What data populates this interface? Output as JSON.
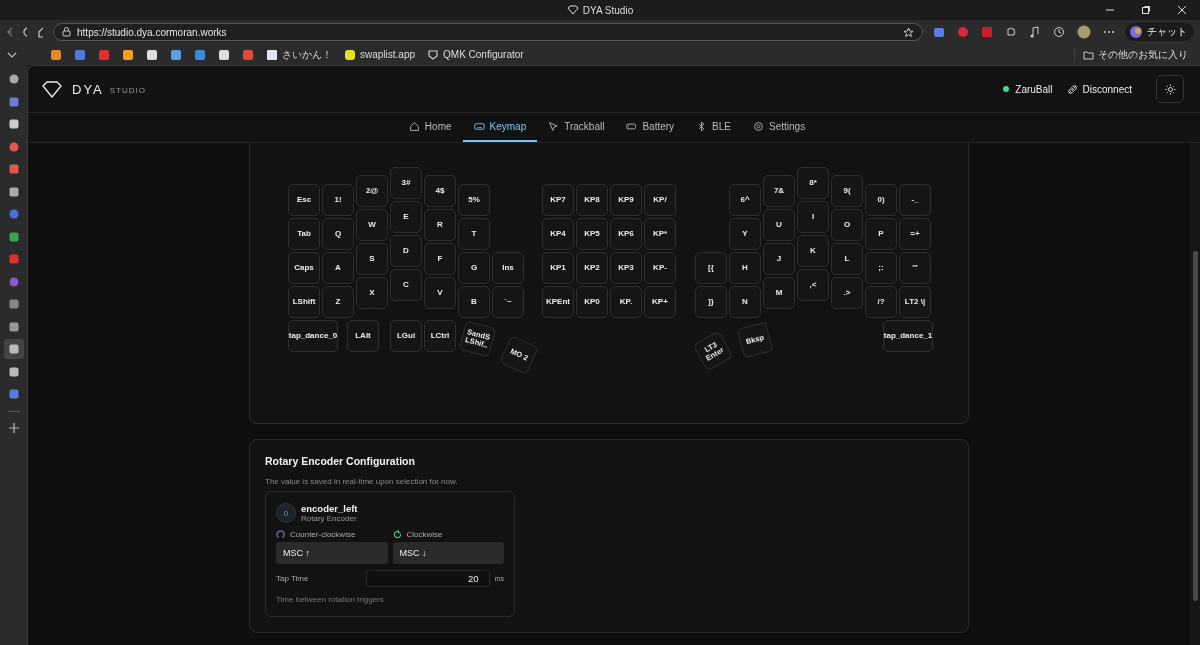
{
  "browser": {
    "title": "DYA Studio",
    "url": "https://studio.dya.cormoran.works",
    "chat_button": "チャット",
    "bookmarks": [
      {
        "label": "さいかん！"
      },
      {
        "label": "swaplist.app"
      },
      {
        "label": "QMK Configurator"
      }
    ],
    "other_bookmarks": "その他のお気に入り"
  },
  "app": {
    "brand": "DYA",
    "brand_sub": "STUDIO",
    "device": {
      "name": "ZaruBall",
      "connected": true
    },
    "disconnect": "Disconnect"
  },
  "tabs": [
    {
      "label": "Home",
      "selected": false
    },
    {
      "label": "Keymap",
      "selected": true
    },
    {
      "label": "Trackball",
      "selected": false
    },
    {
      "label": "Battery",
      "selected": false
    },
    {
      "label": "BLE",
      "selected": false
    },
    {
      "label": "Settings",
      "selected": false
    }
  ],
  "keymap": {
    "left_half": [
      "Esc",
      "1!",
      "2@",
      "3#",
      "4$",
      "5%",
      "Tab",
      "Q",
      "W",
      "E",
      "R",
      "T",
      "Caps",
      "A",
      "S",
      "D",
      "F",
      "G",
      "Ins",
      "LShift",
      "Z",
      "X",
      "C",
      "V",
      "B",
      "`~",
      "tap_dance_0",
      "LAlt",
      "LGui",
      "LCtrl",
      "SandS\nLShif..",
      "MO 2"
    ],
    "numpad": [
      "KP7",
      "KP8",
      "KP9",
      "KP/",
      "KP4",
      "KP5",
      "KP6",
      "KP*",
      "KP1",
      "KP2",
      "KP3",
      "KP-",
      "KPEnt",
      "KP0",
      "KP.",
      "KP+"
    ],
    "right_half": [
      "6^",
      "7&",
      "8*",
      "9(",
      "0)",
      "-_",
      "Y",
      "U",
      "I",
      "O",
      "P",
      "=+",
      "[{",
      "H",
      "J",
      "K",
      "L",
      ";:",
      "'\"",
      "]}",
      "N",
      "M",
      ",<",
      ".>",
      "/?",
      "LT2 \\|",
      "LT3\nEnter",
      "Bksp",
      "tap_dance_1"
    ]
  },
  "encoder_section": {
    "title": "Rotary Encoder Configuration",
    "description": "The value is saved in real-time upon selection for now.",
    "encoder": {
      "badge": "0",
      "name": "encoder_left",
      "type": "Rotary Encoder",
      "counter_clockwise": {
        "label": "Counter-clockwise",
        "value": "MSC ↑"
      },
      "clockwise": {
        "label": "Clockwise",
        "value": "MSC ↓"
      },
      "tap_time": {
        "label": "Tap Time",
        "value": "20",
        "unit": "ms",
        "hint": "Time between rotation triggers"
      }
    }
  }
}
